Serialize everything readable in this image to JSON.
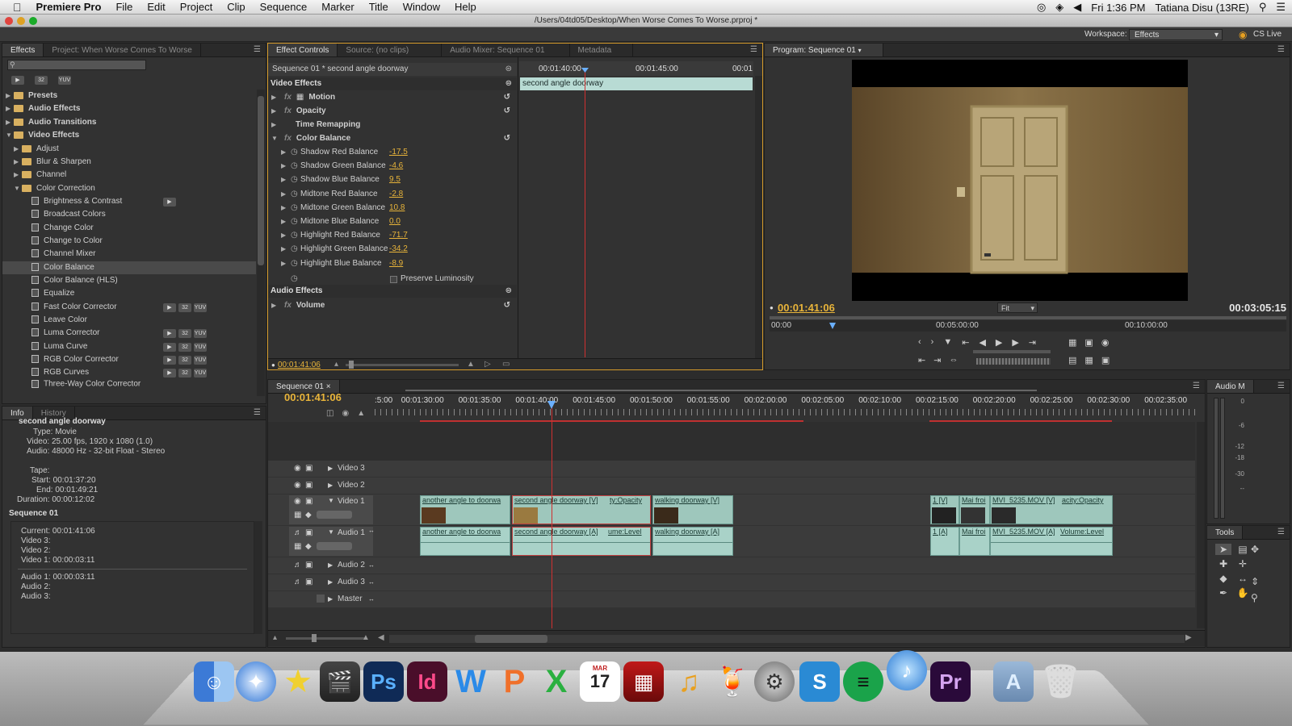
{
  "menubar": {
    "app": "Premiere Pro",
    "items": [
      "File",
      "Edit",
      "Project",
      "Clip",
      "Sequence",
      "Marker",
      "Title",
      "Window",
      "Help"
    ],
    "clock": "Fri 1:36 PM",
    "user": "Tatiana Disu (13RE)"
  },
  "window": {
    "title": "/Users/04td05/Desktop/When Worse Comes To Worse.prproj *"
  },
  "workspace": {
    "label": "Workspace:",
    "value": "Effects",
    "cslive": "CS Live"
  },
  "effects_panel": {
    "tabs": [
      "Effects",
      "Project: When Worse Comes To Worse"
    ],
    "badges": [
      "32",
      "YUV"
    ],
    "folders": [
      "Presets",
      "Audio Effects",
      "Audio Transitions",
      "Video Effects"
    ],
    "subfolders": [
      "Adjust",
      "Blur & Sharpen",
      "Channel",
      "Color Correction"
    ],
    "items": [
      "Brightness & Contrast",
      "Broadcast Colors",
      "Change Color",
      "Change to Color",
      "Channel Mixer",
      "Color Balance",
      "Color Balance (HLS)",
      "Equalize",
      "Fast Color Corrector",
      "Leave Color",
      "Luma Corrector",
      "Luma Curve",
      "RGB Color Corrector",
      "RGB Curves",
      "Three-Way Color Corrector"
    ],
    "selected": "Color Balance"
  },
  "effect_controls": {
    "tabs": [
      "Effect Controls",
      "Source: (no clips)",
      "Audio Mixer: Sequence 01",
      "Metadata"
    ],
    "header": "Sequence 01 * second angle doorway",
    "video_effects": "Video Effects",
    "effects": [
      "Motion",
      "Opacity",
      "Time Remapping",
      "Color Balance"
    ],
    "params": [
      {
        "name": "Shadow Red Balance",
        "value": "-17.5"
      },
      {
        "name": "Shadow Green Balance",
        "value": "-4.6"
      },
      {
        "name": "Shadow Blue Balance",
        "value": "9.5"
      },
      {
        "name": "Midtone Red Balance",
        "value": "-2.8"
      },
      {
        "name": "Midtone Green Balance",
        "value": "10.8"
      },
      {
        "name": "Midtone Blue Balance",
        "value": "0.0"
      },
      {
        "name": "Highlight Red Balance",
        "value": "-71.7"
      },
      {
        "name": "Highlight Green Balance",
        "value": "-34.2"
      },
      {
        "name": "Highlight Blue Balance",
        "value": "-8.9"
      }
    ],
    "preserve": "Preserve Luminosity",
    "audio_effects": "Audio Effects",
    "volume": "Volume",
    "ruler": [
      "00:01:40:00",
      "00:01:45:00",
      "00:01"
    ],
    "clip_label": "second angle doorway",
    "timecode": "00:01:41:06"
  },
  "program": {
    "tab": "Program: Sequence 01",
    "timecode": "00:01:41:06",
    "duration": "00:03:05:15",
    "fit": "Fit",
    "ruler": [
      "00:00",
      "00:05:00:00",
      "00:10:00:00"
    ]
  },
  "info": {
    "tabs": [
      "Info",
      "History"
    ],
    "clip_name": "second angle doorway",
    "lines": [
      "Type: Movie",
      "Video: 25.00 fps, 1920 x 1080 (1.0)",
      "Audio: 48000 Hz - 32-bit Float - Stereo",
      "",
      "Tape:",
      "Start: 00:01:37:20",
      "End: 00:01:49:21",
      "Duration: 00:00:12:02"
    ],
    "sequence": "Sequence 01",
    "seq_lines": [
      "Current: 00:01:41:06",
      "Video 3:",
      "Video 2:",
      "Video 1: 00:00:03:11"
    ],
    "audio_lines": [
      "Audio 1: 00:00:03:11",
      "Audio 2:",
      "Audio 3:"
    ]
  },
  "timeline": {
    "tab": "Sequence 01",
    "timecode": "00:01:41:06",
    "ruler": [
      ":5:00",
      "00:01:30:00",
      "00:01:35:00",
      "00:01:40:00",
      "00:01:45:00",
      "00:01:50:00",
      "00:01:55:00",
      "00:02:00:00",
      "00:02:05:00",
      "00:02:10:00",
      "00:02:15:00",
      "00:02:20:00",
      "00:02:25:00",
      "00:02:30:00",
      "00:02:35:00"
    ],
    "tracks": [
      "Video 3",
      "Video 2",
      "Video 1",
      "Audio 1",
      "Audio 2",
      "Audio 3",
      "Master"
    ],
    "video_clips": [
      "another angle to doorwa",
      "second angle doorway [V]",
      "ty:Opacity",
      "walking doorway [V]",
      "1 [V]",
      "Mai froi",
      "MVI_5235.MOV [V]",
      "acity:Opacity"
    ],
    "audio_clips": [
      "another angle to doorwa",
      "second angle doorway [A]",
      "ume:Level",
      "walking doorway [A]",
      "1 [A]",
      "Mai froi",
      "MVI_5235.MOV [A]",
      "Volume:Level"
    ]
  },
  "audio_meter": {
    "tab": "Audio M",
    "ticks": [
      "0",
      "-6",
      "-12",
      "-18",
      "-30",
      "--"
    ]
  },
  "tools": {
    "tab": "Tools"
  },
  "dock": {
    "apps": [
      "Finder",
      "Safari",
      "iMovie",
      "Final Cut",
      "Ps",
      "Id",
      "W",
      "P",
      "X",
      "17",
      "PhotoBooth",
      "GarageBand",
      "Mixer",
      "System Preferences",
      "S",
      "Spotify",
      "iTunes",
      "Pr",
      "Applications",
      "Trash"
    ],
    "calendar_month": "MAR"
  }
}
